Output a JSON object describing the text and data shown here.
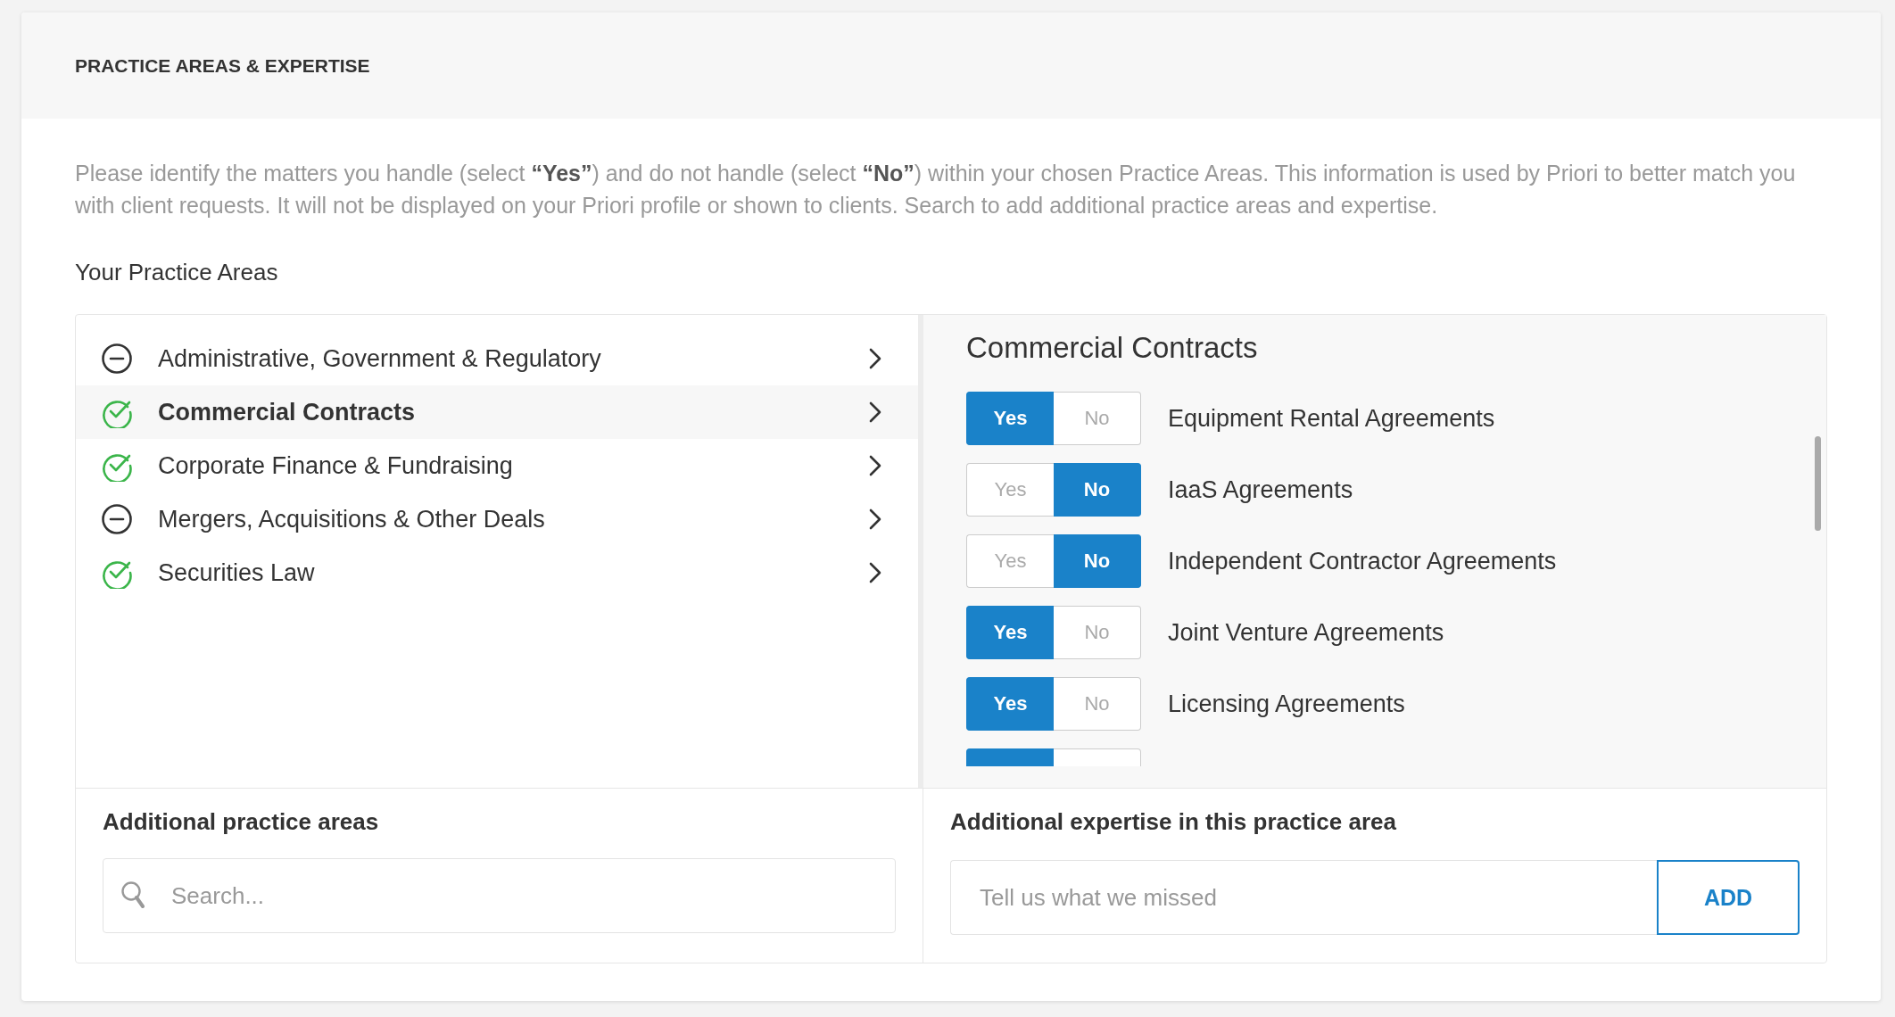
{
  "header": {
    "title": "PRACTICE AREAS & EXPERTISE"
  },
  "description": "Please identify the matters you handle (select **“Yes”**) and do not handle (select **“No”**) within your chosen Practice Areas. This information is used by Priori to better match you with client requests. It will not be displayed on your Priori profile or shown to clients. Search to add additional practice areas and expertise.",
  "section_title": "Your Practice Areas",
  "practice_areas": [
    {
      "label": "Administrative, Government & Regulatory",
      "kind": "excluded",
      "selected": false
    },
    {
      "label": "Commercial Contracts",
      "kind": "included",
      "selected": true
    },
    {
      "label": "Corporate Finance & Fundraising",
      "kind": "included",
      "selected": false
    },
    {
      "label": "Mergers, Acquisitions & Other Deals",
      "kind": "excluded",
      "selected": false
    },
    {
      "label": "Securities Law",
      "kind": "included",
      "selected": false
    }
  ],
  "detail": {
    "title": "Commercial Contracts",
    "items": [
      {
        "label": "Equipment Rental Agreements",
        "yes_label": "Yes",
        "no_label": "No",
        "yes": true
      },
      {
        "label": "IaaS Agreements",
        "yes_label": "Yes",
        "no_label": "No",
        "yes": false
      },
      {
        "label": "Independent Contractor Agreements",
        "yes_label": "Yes",
        "no_label": "No",
        "yes": false
      },
      {
        "label": "Joint Venture Agreements",
        "yes_label": "Yes",
        "no_label": "No",
        "yes": true
      },
      {
        "label": "Licensing Agreements",
        "yes_label": "Yes",
        "no_label": "No",
        "yes": true
      },
      {
        "yes": true
      }
    ]
  },
  "additional_areas": {
    "title": "Additional practice areas",
    "placeholder": "Search..."
  },
  "additional_expertise": {
    "title": "Additional expertise in this practice area",
    "placeholder": "Tell us what we missed",
    "button": "ADD"
  }
}
